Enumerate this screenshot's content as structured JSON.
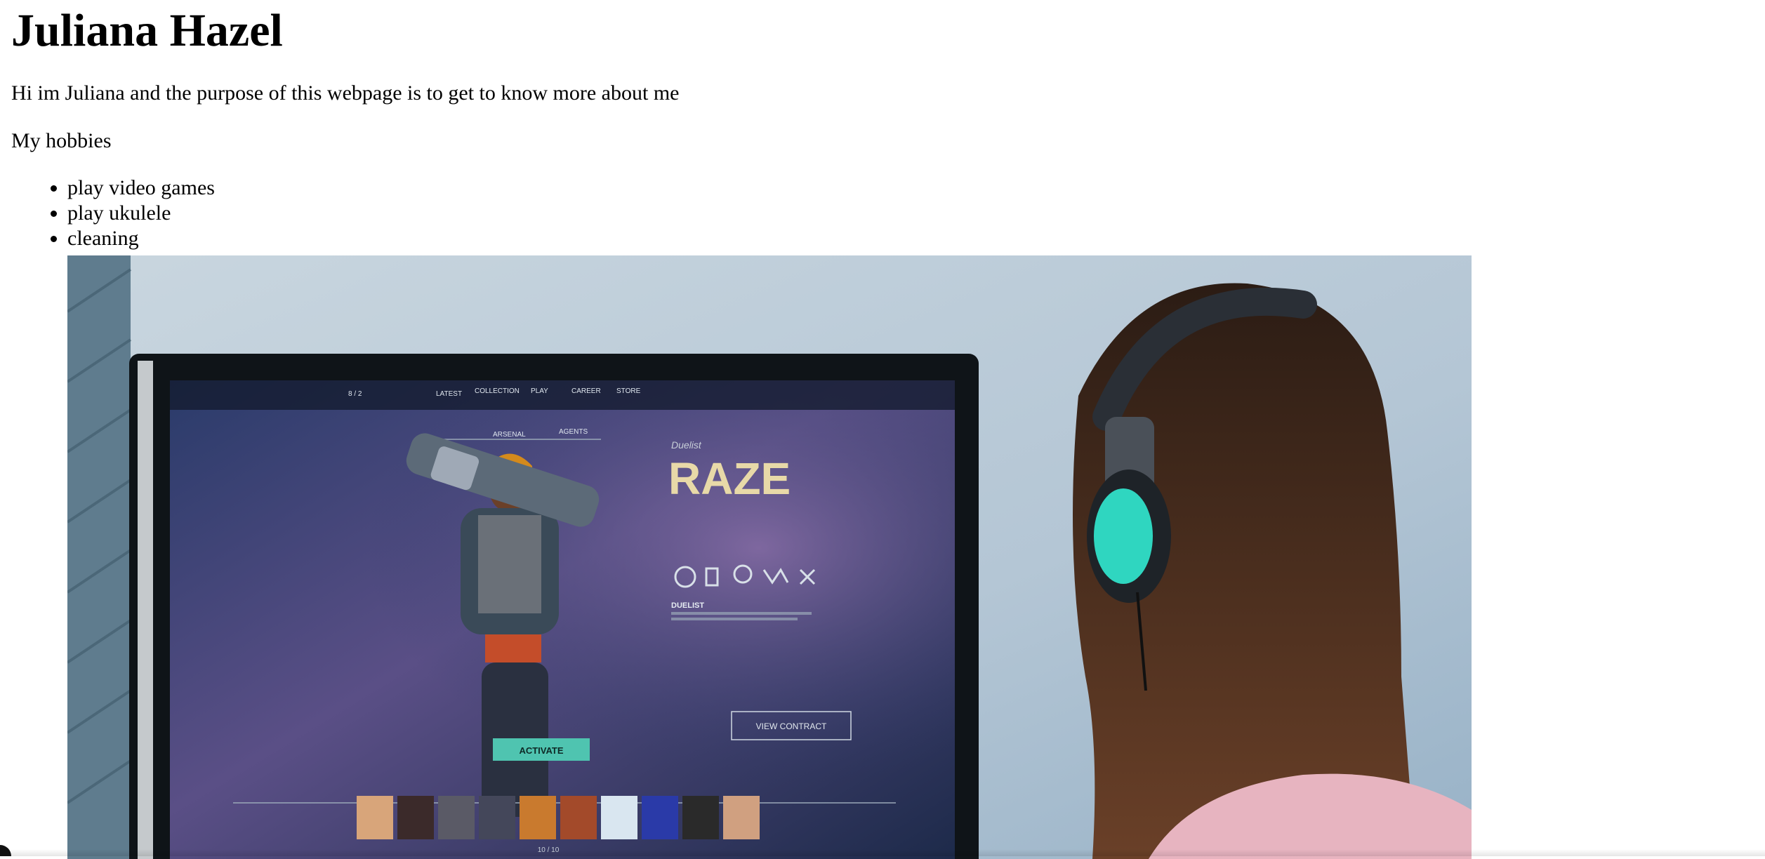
{
  "page": {
    "title": "Juliana Hazel",
    "intro": "Hi im Juliana and the purpose of this webpage is to get to know more about me",
    "hobbies_heading": "My hobbies",
    "hobbies": [
      "play video games",
      "play ukulele",
      "cleaning"
    ]
  },
  "photo": {
    "screen_nav": [
      "LATEST",
      "COLLECTION",
      "PLAY",
      "CAREER",
      "STORE"
    ],
    "screen_tabs": [
      "ARSENAL",
      "AGENTS"
    ],
    "agent_role": "Duelist",
    "agent_name": "RAZE",
    "role_heading": "DUELIST",
    "activate_label": "ACTIVATE",
    "view_contract_label": "VIEW CONTRACT",
    "counter": "8 / 2",
    "pager": "10 / 10"
  },
  "colors": {
    "wall": "#b8cad8",
    "screen_bg": "#2c3560",
    "headphone_accent": "#2fd6c0",
    "hair": "#3a2418",
    "agent_name_color": "#e8d9a8",
    "activate_bg": "#4fc4b0"
  }
}
